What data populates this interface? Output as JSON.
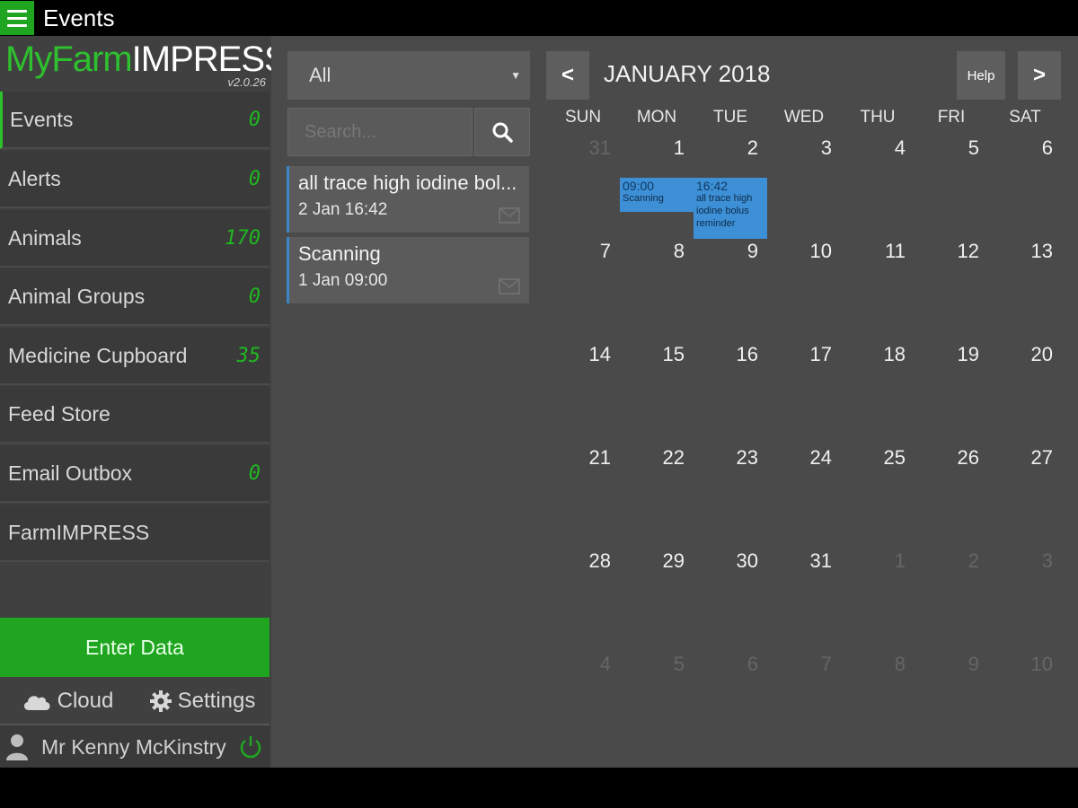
{
  "topbar": {
    "title": "Events"
  },
  "brand": {
    "myfarm": "MyFarm",
    "impress": "IMPRESS",
    "version": "v2.0.26"
  },
  "nav": [
    {
      "label": "Events",
      "count": "0",
      "active": true
    },
    {
      "label": "Alerts",
      "count": "0"
    },
    {
      "label": "Animals",
      "count": "170"
    },
    {
      "label": "Animal Groups",
      "count": "0"
    },
    {
      "label": "Medicine Cupboard",
      "count": "35"
    },
    {
      "label": "Feed Store",
      "count": ""
    },
    {
      "label": "Email Outbox",
      "count": "0"
    },
    {
      "label": "FarmIMPRESS",
      "count": ""
    }
  ],
  "enter_data": "Enter Data",
  "tools": {
    "cloud": "Cloud",
    "settings": "Settings"
  },
  "user": {
    "name": "Mr Kenny McKinstry"
  },
  "filter": {
    "value": "All"
  },
  "search": {
    "placeholder": "Search..."
  },
  "events_list": [
    {
      "title": "all trace high iodine bol...",
      "time": "2 Jan 16:42"
    },
    {
      "title": "Scanning",
      "time": "1 Jan 09:00"
    }
  ],
  "calendar": {
    "prev": "<",
    "next": ">",
    "help": "Help",
    "month": "JANUARY 2018",
    "weekdays": [
      "SUN",
      "MON",
      "TUE",
      "WED",
      "THU",
      "FRI",
      "SAT"
    ],
    "days": [
      "31",
      "1",
      "2",
      "3",
      "4",
      "5",
      "6",
      "7",
      "8",
      "9",
      "10",
      "11",
      "12",
      "13",
      "14",
      "15",
      "16",
      "17",
      "18",
      "19",
      "20",
      "21",
      "22",
      "23",
      "24",
      "25",
      "26",
      "27",
      "28",
      "29",
      "30",
      "31",
      "1",
      "2",
      "3",
      "4",
      "5",
      "6",
      "7",
      "8",
      "9",
      "10"
    ],
    "other_month": [
      0,
      32,
      33,
      34,
      35,
      36,
      37,
      38,
      39,
      40,
      41
    ],
    "events": [
      {
        "time": "09:00",
        "text": "Scanning"
      },
      {
        "time": "16:42",
        "text": "all trace high iodine bolus reminder"
      }
    ]
  },
  "colors": {
    "accent": "#1fa51f",
    "event_blue": "#3d8fd6"
  }
}
